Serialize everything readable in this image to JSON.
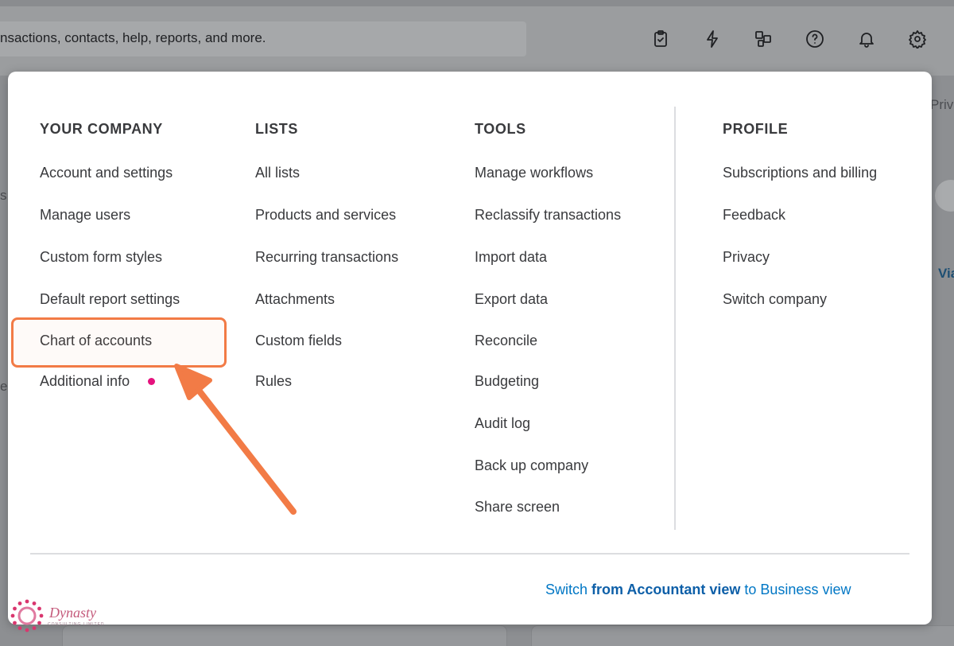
{
  "search": {
    "text": "nsactions, contacts, help, reports, and more."
  },
  "top_icons": [
    "clipboard-check-icon",
    "lightning-icon",
    "apps-icon",
    "help-icon",
    "bell-icon",
    "gear-icon"
  ],
  "background": {
    "priv": "Priv",
    "via": "Via",
    "s": "s",
    "e": "e"
  },
  "menu": {
    "your_company": {
      "heading": "YOUR COMPANY",
      "items": [
        "Account and settings",
        "Manage users",
        "Custom form styles",
        "Default report settings",
        "Chart of accounts",
        "Additional info"
      ]
    },
    "lists": {
      "heading": "LISTS",
      "items": [
        "All lists",
        "Products and services",
        "Recurring transactions",
        "Attachments",
        "Custom fields",
        "Rules"
      ]
    },
    "tools": {
      "heading": "TOOLS",
      "items": [
        "Manage workflows",
        "Reclassify transactions",
        "Import data",
        "Export data",
        "Reconcile",
        "Budgeting",
        "Audit log",
        "Back up company",
        "Share screen"
      ]
    },
    "profile": {
      "heading": "PROFILE",
      "items": [
        "Subscriptions and billing",
        "Feedback",
        "Privacy",
        "Switch company"
      ]
    },
    "switch_view": {
      "part1": "Switch ",
      "part2": "from Accountant view",
      "part3": " to Business view"
    }
  },
  "watermark": {
    "name": "Dynasty",
    "sub": "CONSULTING LIMITED"
  },
  "colors": {
    "highlight": "#f27b46",
    "link": "#0077c5",
    "dot": "#e5127d"
  }
}
